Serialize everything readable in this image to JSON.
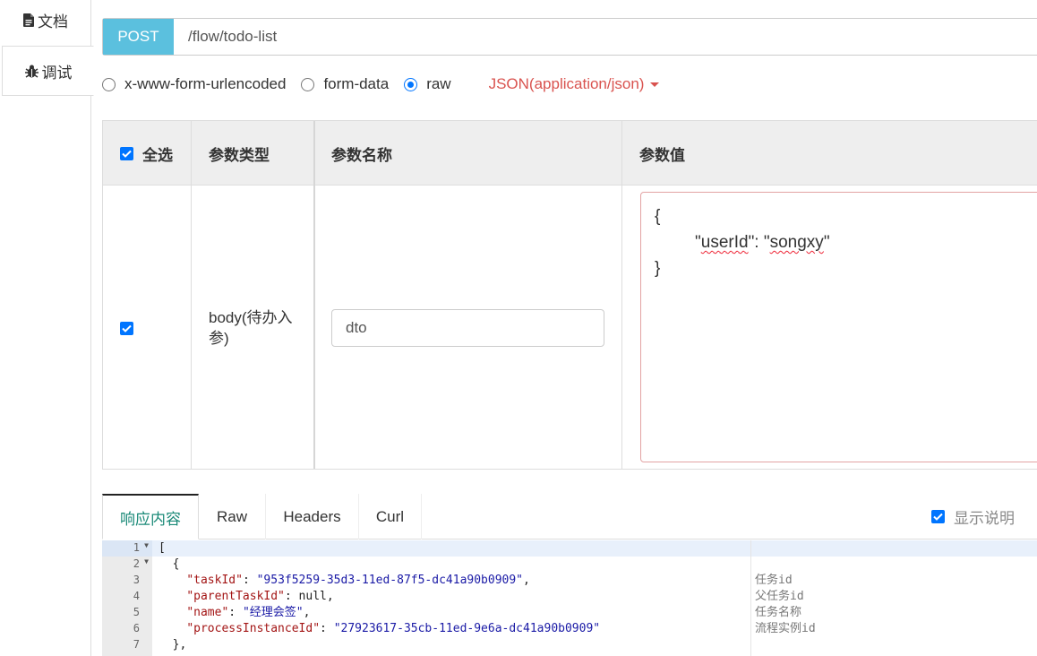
{
  "left_tabs": [
    {
      "label": "文档",
      "icon": "document-icon"
    },
    {
      "label": "调试",
      "icon": "bug-icon"
    }
  ],
  "request": {
    "method": "POST",
    "url": "/flow/todo-list"
  },
  "content_types": {
    "options": [
      "x-www-form-urlencoded",
      "form-data",
      "raw"
    ],
    "selected": "raw",
    "raw_format": "JSON(application/json)"
  },
  "params_table": {
    "headers": {
      "select_all": "全选",
      "type": "参数类型",
      "name": "参数名称",
      "value": "参数值"
    },
    "rows": [
      {
        "checked": true,
        "type": "body(待办入参)",
        "name": "dto",
        "value_lines": [
          "{",
          "\"userId\": \"songxy\"",
          "}"
        ]
      }
    ]
  },
  "response": {
    "tabs": [
      "响应内容",
      "Raw",
      "Headers",
      "Curl"
    ],
    "active_tab": "响应内容",
    "show_description_label": "显示说明",
    "show_description_checked": true,
    "line_numbers": [
      "1",
      "2",
      "3",
      "4",
      "5",
      "6",
      "7"
    ],
    "code_lines": [
      {
        "key": "",
        "value": "["
      },
      {
        "key": "",
        "value": "  {"
      },
      {
        "key": "\"taskId\"",
        "value": "\"953f5259-35d3-11ed-87f5-dc41a90b0909\""
      },
      {
        "key": "\"parentTaskId\"",
        "value": "null"
      },
      {
        "key": "\"name\"",
        "value": "\"经理会签\""
      },
      {
        "key": "\"processInstanceId\"",
        "value": "\"27923617-35cb-11ed-9e6a-dc41a90b0909\""
      },
      {
        "key": "",
        "value": "  },"
      }
    ],
    "descriptions": [
      "任务id",
      "父任务id",
      "任务名称",
      "流程实例id"
    ]
  },
  "colors": {
    "method_bg": "#5bc0de",
    "json_selector": "#d9534f",
    "active_tab_text": "#1b8a78",
    "checkbox": "#0075ff",
    "json_key": "#a31515",
    "json_string": "#1a1aa6"
  }
}
